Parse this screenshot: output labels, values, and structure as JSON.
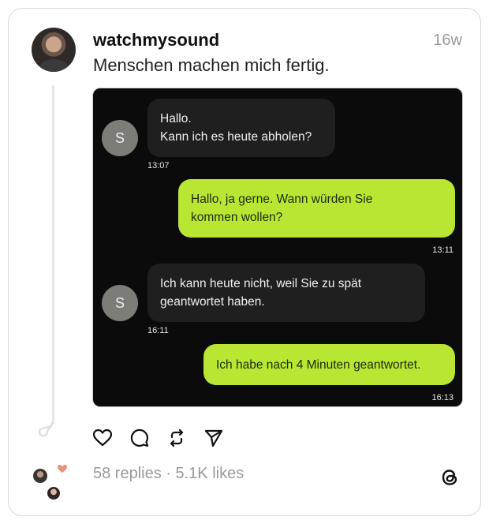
{
  "post": {
    "username": "watchmysound",
    "time_ago": "16w",
    "text": "Menschen machen mich fertig."
  },
  "chat": {
    "messages": [
      {
        "direction": "incoming",
        "avatar_letter": "S",
        "lines": [
          "Hallo.",
          "Kann ich es heute abholen?"
        ],
        "time": "13:07"
      },
      {
        "direction": "outgoing",
        "lines": [
          "Hallo, ja gerne. Wann würden Sie",
          "kommen wollen?"
        ],
        "time": "13:11"
      },
      {
        "direction": "incoming",
        "avatar_letter": "S",
        "lines": [
          "Ich kann heute nicht, weil Sie zu spät",
          "geantwortet haben."
        ],
        "time": "16:11"
      },
      {
        "direction": "outgoing",
        "lines": [
          "Ich habe nach 4 Minuten geantwortet."
        ],
        "time": "16:13"
      }
    ],
    "colors": {
      "background": "#0b0b0b",
      "incoming_bubble": "#1f1f1f",
      "outgoing_bubble": "#b8e633"
    }
  },
  "actions": {
    "icons": [
      "heart-icon",
      "comment-icon",
      "repost-icon",
      "share-icon"
    ]
  },
  "stats": {
    "text": "58 replies · 5.1K likes"
  }
}
